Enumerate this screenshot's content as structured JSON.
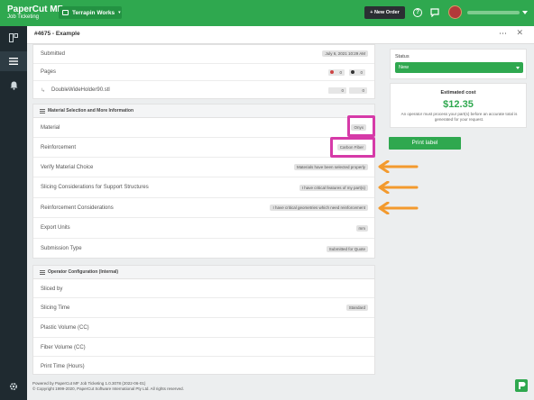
{
  "brand": {
    "name": "PaperCut MF",
    "subtitle": "Job Ticketing"
  },
  "org": {
    "label": "Terrapin Works"
  },
  "topbar": {
    "new_order_label": "+ New Order",
    "help_glyph": "?"
  },
  "header": {
    "title": "#4675 - Example",
    "more_glyph": "⋯",
    "close_glyph": "✕"
  },
  "job": {
    "rows": [
      {
        "label": "Submitted",
        "value": "July 6, 2021 10:29 AM"
      },
      {
        "label": "Pages",
        "value": ""
      }
    ],
    "pages_counts": [
      "0",
      "0"
    ],
    "file": {
      "name": "DoubleWideHolder90.stl",
      "counts": [
        "0",
        "0"
      ]
    }
  },
  "material_section": {
    "title": "Material Selection and More Information",
    "rows": [
      {
        "label": "Material",
        "value": "Onyx"
      },
      {
        "label": "Reinforcement",
        "value": "Carbon Fiber"
      },
      {
        "label": "Verify Material Choice",
        "value": "Materials have been selected properly"
      },
      {
        "label": "Slicing Considerations for Support Structures",
        "value": "I have critical features of my part(s)"
      },
      {
        "label": "Reinforcement Considerations",
        "value": "I have critical geometries which need reinforcement"
      },
      {
        "label": "Export Units",
        "value": "mm"
      },
      {
        "label": "Submission Type",
        "value": "Submitted for Quote"
      }
    ]
  },
  "operator_section": {
    "title": "Operator Configuration (Internal)",
    "rows": [
      {
        "label": "Sliced by",
        "value": ""
      },
      {
        "label": "Slicing Time",
        "value": "Standard"
      },
      {
        "label": "Plastic Volume (CC)",
        "value": ""
      },
      {
        "label": "Fiber Volume (CC)",
        "value": ""
      },
      {
        "label": "Print Time (Hours)",
        "value": ""
      }
    ]
  },
  "status": {
    "label": "Status",
    "value": "New"
  },
  "cost": {
    "label": "Estimated cost",
    "value": "$12.35",
    "note": "An operator must process your part(s) before an accurate total is generated for your request."
  },
  "print_button": {
    "label": "Print label"
  },
  "footer": {
    "line1": "Powered by PaperCut MF Job Ticketing 1.0.3078 (2022-06-01)",
    "line2": "© Copyright 1999-2020, PaperCut Software International Pty Ltd. All rights reserved."
  },
  "colors": {
    "brand_green": "#2fa84f",
    "sidebar": "#1f2a30",
    "highlight": "#d63aa8",
    "arrow": "#f39a2e"
  },
  "icons": [
    "layout-icon",
    "list-icon",
    "bell-icon",
    "gear-icon",
    "chat-icon",
    "help-icon",
    "list-section-icon",
    "file-icon"
  ]
}
